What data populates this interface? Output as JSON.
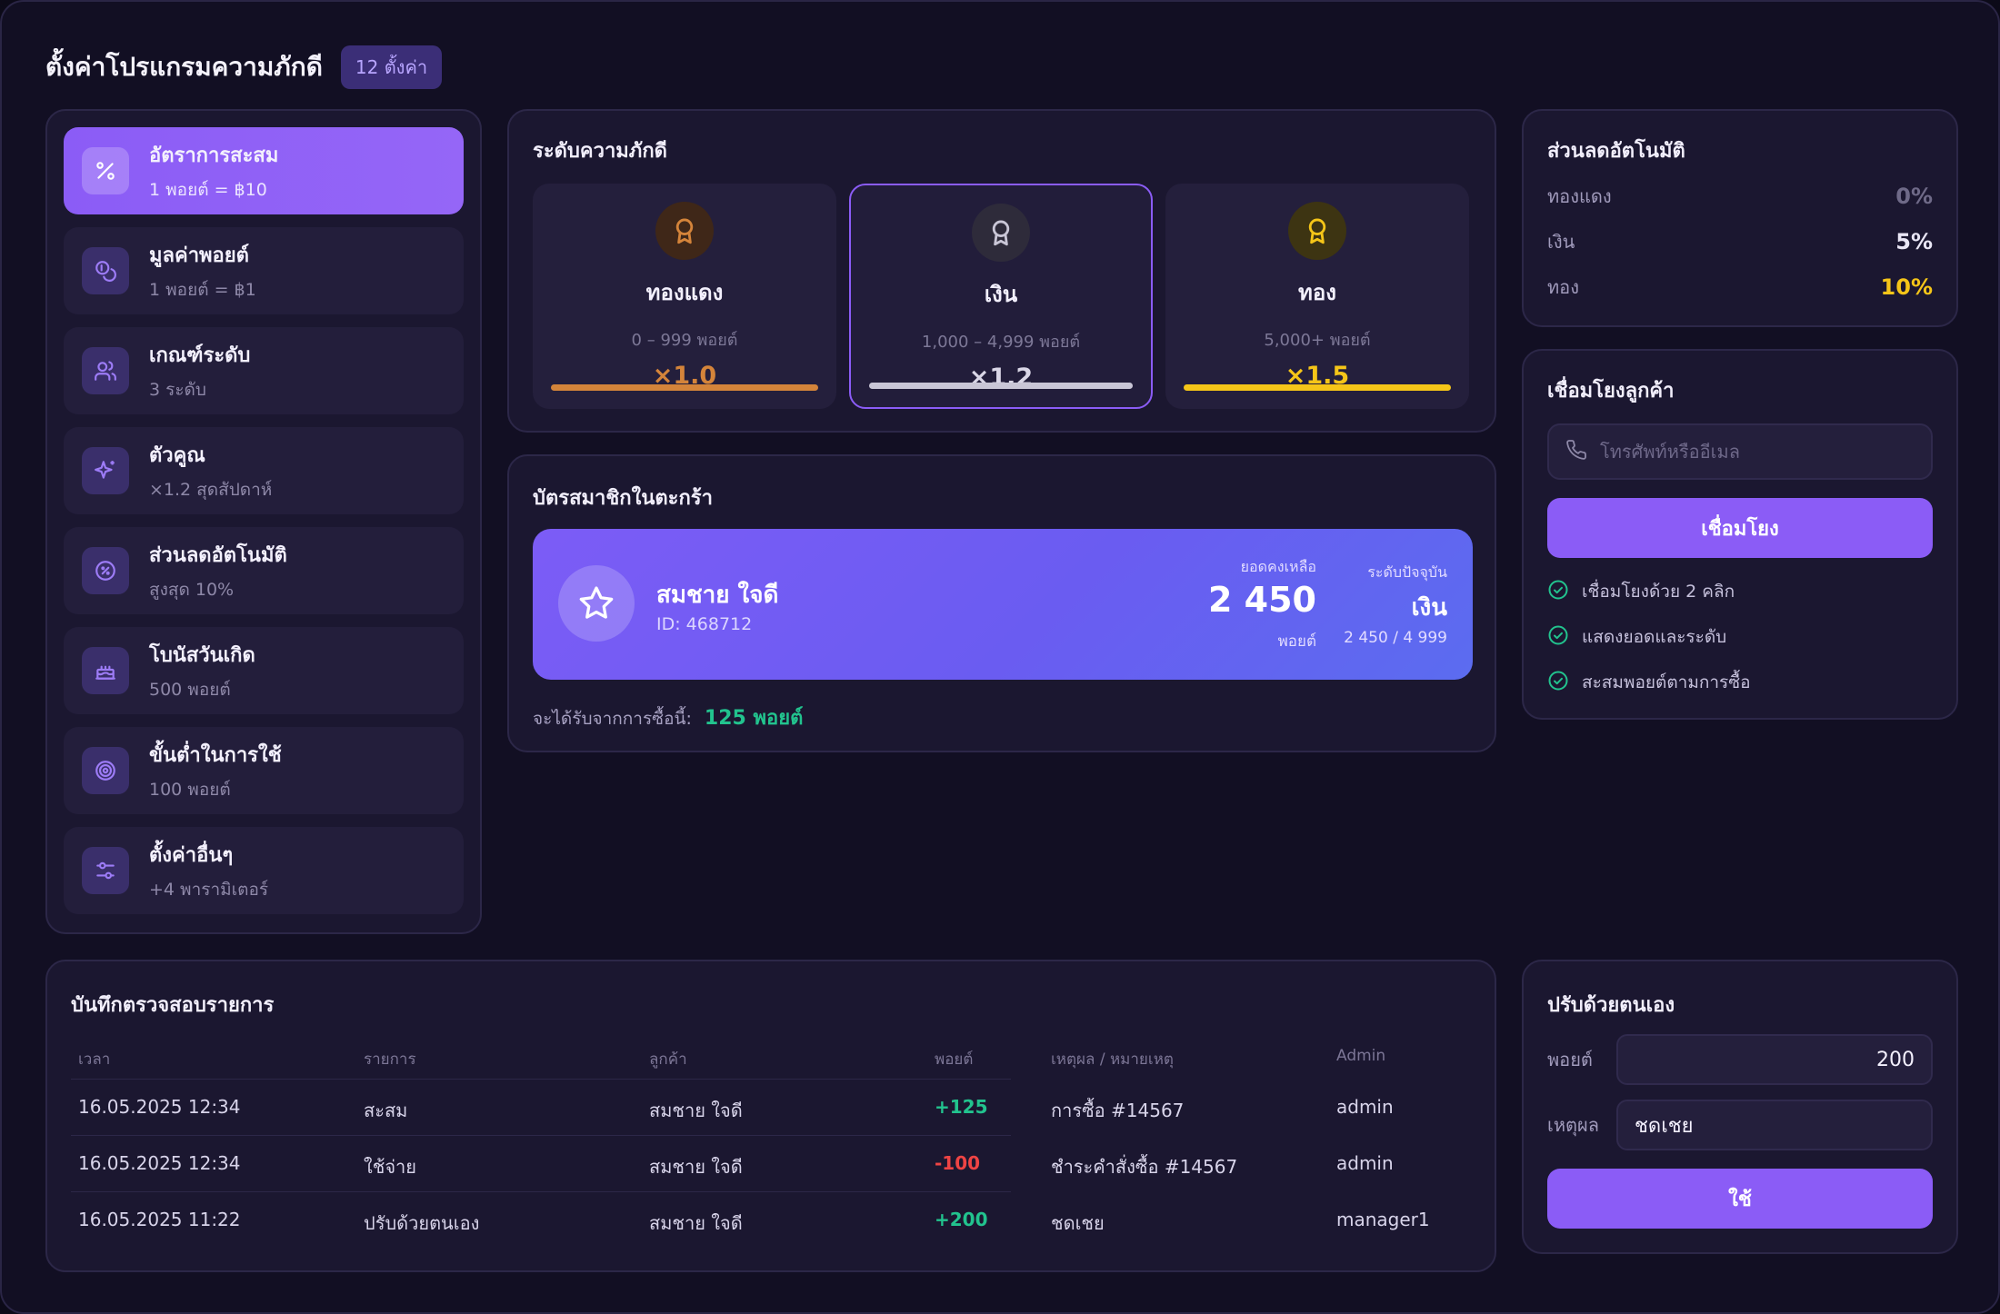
{
  "header": {
    "title": "ตั้งค่าโปรแกรมความภักดี",
    "badge": "12 ตั้งค่า"
  },
  "sidebar": {
    "items": [
      {
        "label": "อัตราการสะสม",
        "sub": "1 พอยต์ = ฿10",
        "icon": "percent-icon",
        "active": true
      },
      {
        "label": "มูลค่าพอยต์",
        "sub": "1 พอยต์ = ฿1",
        "icon": "coins-icon"
      },
      {
        "label": "เกณฑ์ระดับ",
        "sub": "3 ระดับ",
        "icon": "users-icon"
      },
      {
        "label": "ตัวคูณ",
        "sub": "×1.2 สุดสัปดาห์",
        "icon": "sparkles-icon"
      },
      {
        "label": "ส่วนลดอัตโนมัติ",
        "sub": "สูงสุด 10%",
        "icon": "discount-badge-icon"
      },
      {
        "label": "โบนัสวันเกิด",
        "sub": "500 พอยต์",
        "icon": "cake-icon"
      },
      {
        "label": "ขั้นต่ำในการใช้",
        "sub": "100 พอยต์",
        "icon": "target-icon"
      },
      {
        "label": "ตั้งค่าอื่นๆ",
        "sub": "+4 พารามิเตอร์",
        "icon": "sliders-icon"
      }
    ]
  },
  "tiers": {
    "title": "ระดับความภักดี",
    "items": [
      {
        "name": "ทองแดง",
        "range": "0 – 999 พอยต์",
        "multiplier": "×1.0",
        "color": "#d4843a",
        "bar_color": "#d4843a"
      },
      {
        "name": "เงิน",
        "range": "1,000 – 4,999 พอยต์",
        "multiplier": "×1.2",
        "color": "#c9c6d6",
        "bar_color": "#c9c6d6",
        "selected": true
      },
      {
        "name": "ทอง",
        "range": "5,000+ พอยต์",
        "multiplier": "×1.5",
        "color": "#f5c518",
        "bar_color": "#f5c518"
      }
    ]
  },
  "member_card": {
    "title": "บัตรสมาชิกในตะกร้า",
    "name": "สมชาย ใจดี",
    "id": "ID: 468712",
    "balance_label": "ยอดคงเหลือ",
    "balance": "2 450",
    "balance_unit": "พอยต์",
    "level_label": "ระดับปัจจุบัน",
    "level": "เงิน",
    "level_progress": "2 450 / 4 999",
    "earn_label": "จะได้รับจากการซื้อนี้:",
    "earn_value": "125 พอยต์"
  },
  "auto_discount": {
    "title": "ส่วนลดอัตโนมัติ",
    "rows": [
      {
        "name": "ทองแดง",
        "value": "0%",
        "color": "#6f6a88"
      },
      {
        "name": "เงิน",
        "value": "5%",
        "color": "#e9e6f5"
      },
      {
        "name": "ทอง",
        "value": "10%",
        "color": "#f5c518"
      }
    ]
  },
  "link_customer": {
    "title": "เชื่อมโยงลูกค้า",
    "placeholder": "โทรศัพท์หรืออีเมล",
    "button": "เชื่อมโยง",
    "checks": [
      "เชื่อมโยงด้วย 2 คลิก",
      "แสดงยอดและระดับ",
      "สะสมพอยต์ตามการซื้อ"
    ]
  },
  "audit": {
    "title": "บันทึกตรวจสอบรายการ",
    "columns": [
      "เวลา",
      "รายการ",
      "ลูกค้า",
      "พอยต์",
      "เหตุผล / หมายเหตุ",
      "Admin"
    ],
    "rows": [
      {
        "time": "16.05.2025 12:34",
        "action": "สะสม",
        "customer": "สมชาย ใจดี",
        "points": "+125",
        "note": "การซื้อ #14567",
        "admin": "admin"
      },
      {
        "time": "16.05.2025 12:34",
        "action": "ใช้จ่าย",
        "customer": "สมชาย ใจดี",
        "points": "-100",
        "note": "ชำระคำสั่งซื้อ #14567",
        "admin": "admin"
      },
      {
        "time": "16.05.2025 11:22",
        "action": "ปรับด้วยตนเอง",
        "customer": "สมชาย ใจดี",
        "points": "+200",
        "note": "ชดเชย",
        "admin": "manager1"
      }
    ]
  },
  "manual": {
    "title": "ปรับด้วยตนเอง",
    "points_label": "พอยต์",
    "points_value": "200",
    "reason_label": "เหตุผล",
    "reason_value": "ชดเชย",
    "button": "ใช้"
  },
  "colors": {
    "accent": "#8b5cf6",
    "positive": "#22c38e",
    "negative": "#ef4444"
  }
}
